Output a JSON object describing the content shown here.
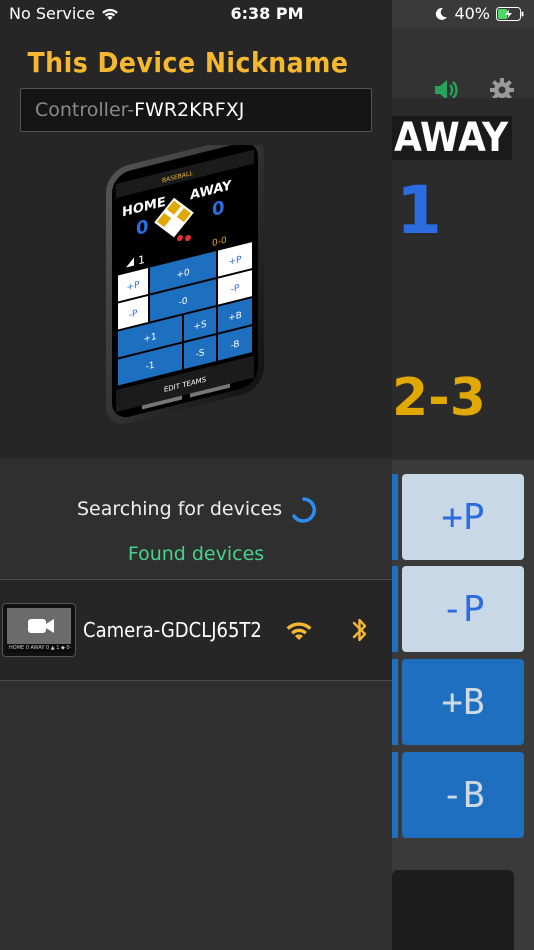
{
  "status_bar": {
    "carrier": "No Service",
    "time": "6:38 PM",
    "battery": "40%"
  },
  "background_app": {
    "away_label": "AWAY",
    "away_score": "1",
    "count": "2-3",
    "buttons": [
      {
        "label": "+P",
        "style": "light"
      },
      {
        "label": "-P",
        "style": "light"
      },
      {
        "label": "+B",
        "style": "blue"
      },
      {
        "label": "-B",
        "style": "blue"
      }
    ],
    "icons": [
      "speaker-icon",
      "gear-icon"
    ]
  },
  "panel": {
    "title": "This Device Nickname",
    "nickname_prefix": "Controller-",
    "nickname_value": "FWR2KRFXJ",
    "illustration": {
      "sport": "BASEBALL",
      "home": "HOME",
      "away": "AWAY",
      "home_score": "0",
      "away_score": "0",
      "inning": "1",
      "count": "0-0",
      "grid_buttons": [
        "+P",
        "+0",
        "+P",
        "-P",
        "-0",
        "-P",
        "+1",
        "+S",
        "+B",
        "-1",
        "-S",
        "-B"
      ],
      "footer": "EDIT TEAMS"
    },
    "searching_text": "Searching for devices",
    "found_text": "Found devices",
    "devices": [
      {
        "name": "Camera-GDCLJ65T2",
        "thumb_strip": "HOME 0 AWAY 0 ▲ 1 ◆ 0-0"
      }
    ]
  },
  "colors": {
    "accent_yellow": "#f5b82e",
    "found_green": "#47d18c",
    "spinner_blue": "#2b8ef0",
    "score_blue": "#2b6de0"
  }
}
